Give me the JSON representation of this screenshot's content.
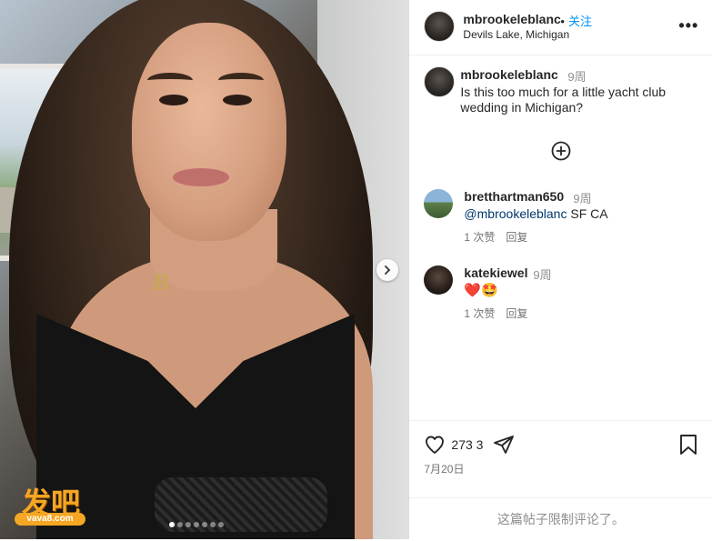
{
  "post": {
    "owner": "mbrookeleblanc",
    "follow_separator": "•",
    "follow_label": "关注",
    "location": "Devils Lake, Michigan",
    "more_icon": "more-options-icon"
  },
  "caption": {
    "username": "mbrookeleblanc",
    "time": "9周",
    "text": "Is this too much for a little yacht club wedding in Michigan?"
  },
  "comments": [
    {
      "username": "bretthartman650",
      "time": "9周",
      "mention": "@mbrookeleblanc",
      "text": " SF CA",
      "likes": "1 次赞",
      "reply": "回复"
    },
    {
      "username": "katekiewel",
      "time": "9周",
      "text": "❤️🤩",
      "likes": "1 次赞",
      "reply": "回复"
    }
  ],
  "actions": {
    "like_count": "273 3",
    "date": "7月20日",
    "comments_disabled": "这篇帖子限制评论了。"
  },
  "media": {
    "necklace_letter": "B",
    "watermark_text": "发吧",
    "watermark_url": "vava8.com",
    "carousel_total": 7,
    "carousel_active": 0
  },
  "colors": {
    "link_blue": "#0095f6",
    "mention_blue": "#00376b",
    "muted": "#8e8e8e",
    "border": "#dbdbdb"
  }
}
